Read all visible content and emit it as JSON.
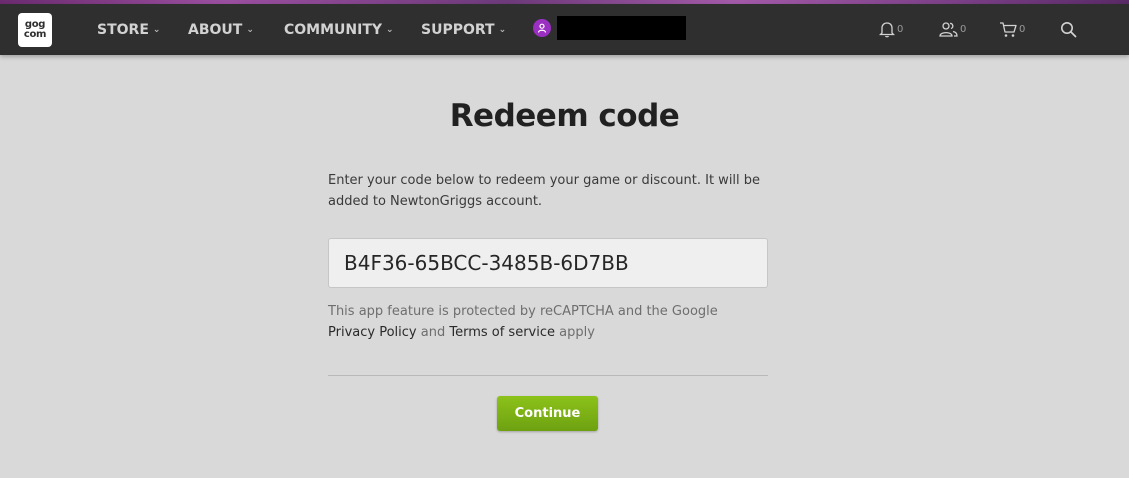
{
  "header": {
    "logo_top": "gog",
    "logo_bottom": "com",
    "nav": [
      {
        "label": "STORE"
      },
      {
        "label": "ABOUT"
      },
      {
        "label": "COMMUNITY"
      },
      {
        "label": "SUPPORT"
      }
    ],
    "icons": {
      "notifications": {
        "icon": "bell-icon",
        "count": "0"
      },
      "friends": {
        "icon": "friends-icon",
        "count": "0"
      },
      "cart": {
        "icon": "cart-icon",
        "count": "0"
      },
      "search": {
        "icon": "search-icon"
      }
    },
    "avatar_color": "#9a2fc2"
  },
  "main": {
    "title": "Redeem code",
    "description": "Enter your code below to redeem your game or discount. It will be added to NewtonGriggs account.",
    "code_value": "B4F36-65BCC-3485B-6D7BB",
    "captcha": {
      "prefix": "This app feature is protected by reCAPTCHA and the Google ",
      "privacy_link": "Privacy Policy",
      "middle": " and ",
      "terms_link": "Terms of service",
      "suffix": " apply"
    },
    "continue_label": "Continue"
  },
  "colors": {
    "navbar": "#2f2f2f",
    "background": "#d9d9d9",
    "button": "#7ab317"
  }
}
